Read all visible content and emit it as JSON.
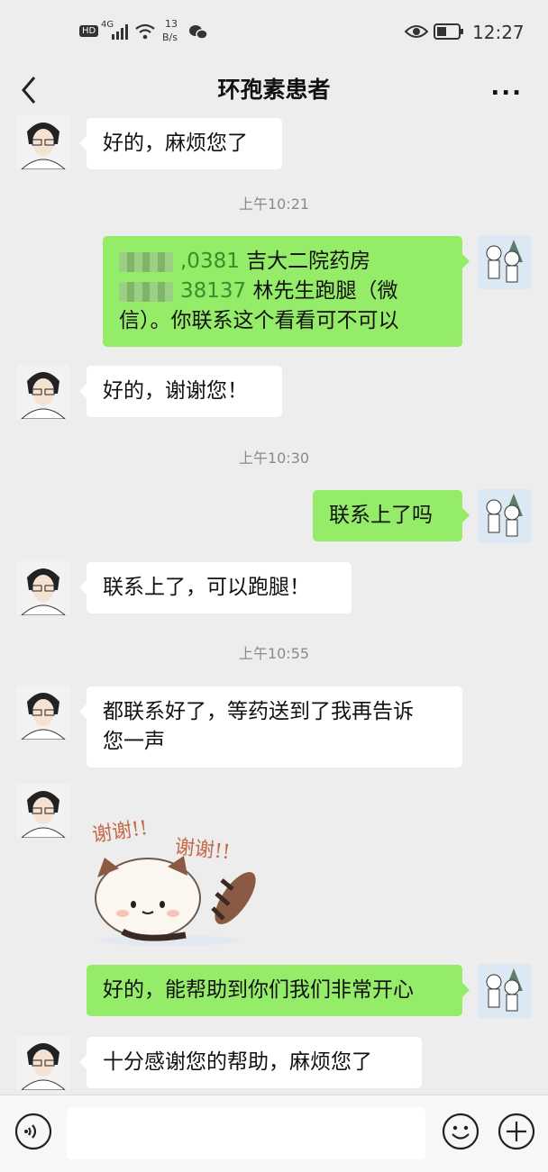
{
  "status": {
    "hd": "HD",
    "signal": "4G",
    "speed_num": "13",
    "speed_unit": "B/s",
    "time": "12:27"
  },
  "header": {
    "title": "环孢素患者",
    "more": "..."
  },
  "messages": {
    "m1": "好的，麻烦您了",
    "t1": "上午10:21",
    "m2_line1_num": ",0381",
    "m2_line1_text": " 吉大二院药房",
    "m2_line2_num": "38137",
    "m2_line2_text": " 林先生跑腿（微",
    "m2_line3": "信）。你联系这个看看可不可以",
    "m3": "好的，谢谢您！",
    "t2": "上午10:30",
    "m4": "联系上了吗",
    "m5": "联系上了，可以跑腿！",
    "t3": "上午10:55",
    "m6_line1": "都联系好了，等药送到了我再告诉",
    "m6_line2": "您一声",
    "sticker_text1": "谢谢!!",
    "sticker_text2": "谢谢!!",
    "m7": "好的，能帮助到你们我们非常开心",
    "m8": "十分感谢您的帮助，麻烦您了"
  },
  "icons": [
    "back-arrow-icon",
    "more-icon",
    "voice-icon",
    "emoji-icon",
    "plus-icon"
  ],
  "colors": {
    "sent_bubble": "#95ec69",
    "received_bubble": "#ffffff",
    "background": "#ededed"
  }
}
